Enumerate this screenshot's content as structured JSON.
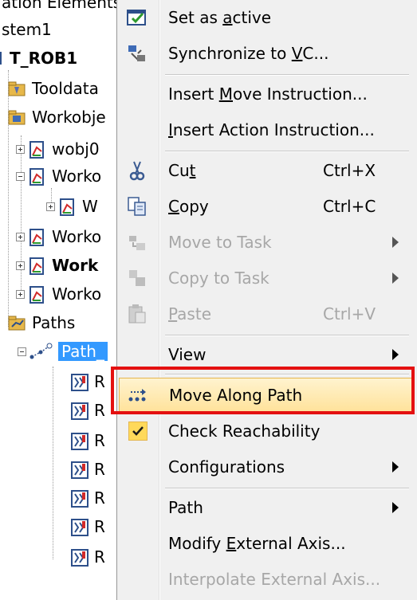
{
  "tree": {
    "header_text": "ation Elements",
    "nodes": [
      {
        "label": "stem1"
      },
      {
        "label": "T_ROB1"
      },
      {
        "label": "Tooldata"
      },
      {
        "label": "Workobje"
      },
      {
        "label": "wobj0"
      },
      {
        "label": "Worko"
      },
      {
        "label": "W"
      },
      {
        "label": "Worko"
      },
      {
        "label": "Work"
      },
      {
        "label": "Worko"
      },
      {
        "label": "Paths"
      },
      {
        "label": "Path_"
      },
      {
        "label": "R"
      },
      {
        "label": "R"
      },
      {
        "label": "R"
      },
      {
        "label": "R"
      },
      {
        "label": "R"
      },
      {
        "label": "R"
      },
      {
        "label": "R"
      }
    ]
  },
  "menu": {
    "items": [
      {
        "label": "Set as active",
        "access_key": "a",
        "icon": "set-active-icon"
      },
      {
        "label": "Synchronize to VC...",
        "access_key": "V",
        "icon": "synchronize-icon"
      },
      {
        "label": "Insert Move Instruction...",
        "access_key": "M"
      },
      {
        "label": "Insert Action Instruction...",
        "access_key": "I"
      },
      {
        "label": "Cut",
        "access_key": "t",
        "shortcut": "Ctrl+X",
        "icon": "scissors-icon"
      },
      {
        "label": "Copy",
        "access_key": "C",
        "shortcut": "Ctrl+C",
        "icon": "copy-icon"
      },
      {
        "label": "Move to Task",
        "disabled": true,
        "submenu": true,
        "icon": "move-to-task-icon"
      },
      {
        "label": "Copy to Task",
        "disabled": true,
        "submenu": true,
        "icon": "copy-to-task-icon"
      },
      {
        "label": "Paste",
        "access_key": "P",
        "shortcut": "Ctrl+V",
        "disabled": true,
        "icon": "paste-icon"
      },
      {
        "label": "View",
        "submenu": true
      },
      {
        "label": "Move Along Path",
        "highlighted": true,
        "icon": "move-along-path-icon"
      },
      {
        "label": "Check Reachability",
        "checked": true,
        "icon": "checkmark-icon"
      },
      {
        "label": "Configurations",
        "submenu": true
      },
      {
        "label": "Path",
        "submenu": true
      },
      {
        "label": "Modify External Axis...",
        "access_key": "E"
      },
      {
        "label": "Interpolate External Axis...",
        "disabled": true
      }
    ]
  },
  "colors": {
    "highlight_border": "#e41010",
    "selection": "#3399ff",
    "menu_bg": "#f0f0f0",
    "disabled_text": "#a7a7a7"
  }
}
